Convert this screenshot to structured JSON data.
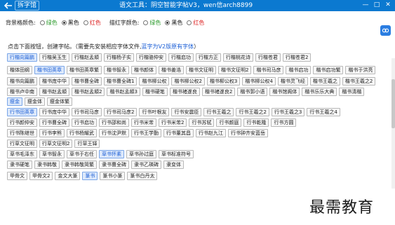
{
  "window": {
    "back_label": "拆字馆",
    "title": "语文工具：阴空智能字帖V3，wen信arch8899",
    "buttons": [
      "—",
      "□",
      "✕"
    ]
  },
  "settings": {
    "bg_label": "背景格颜色:",
    "bg_options": [
      "绿色",
      "黑色",
      "红色"
    ],
    "bg_selected": 1,
    "trace_label": "描红字颜色:",
    "trace_options": [
      "绿色",
      "黑色",
      "红色"
    ],
    "trace_selected": 1
  },
  "hint": {
    "prefix": "点击下面按钮，创建字帖。（需要先安装相应字体文件,",
    "blue": "蓝字为V2版原有字体",
    "suffix": "）"
  },
  "font_rows": [
    [
      {
        "label": "行楷向篇鹏",
        "blue": true,
        "selected": true
      },
      {
        "label": "行楷吴玉生"
      },
      {
        "label": "行楷赵孟頫"
      },
      {
        "label": "行楷杨子实"
      },
      {
        "label": "行楷骆仲安"
      },
      {
        "label": "行楷启功"
      },
      {
        "label": "行楷方正"
      },
      {
        "label": "行楷桃花诗"
      },
      {
        "label": "行楷苍君"
      },
      {
        "label": "行楷苍君2"
      }
    ],
    [
      {
        "label": "楷体田纲"
      },
      {
        "label": "楷书田英章",
        "blue": true,
        "selected": true
      },
      {
        "label": "楷书田英章繁"
      },
      {
        "label": "楷书智永"
      },
      {
        "label": "楷书颜体"
      },
      {
        "label": "楷书姜浩"
      },
      {
        "label": "楷书文征明"
      },
      {
        "label": "楷书文征明2"
      },
      {
        "label": "楷书司马彦"
      },
      {
        "label": "楷书启功"
      },
      {
        "label": "楷书启功繁"
      },
      {
        "label": "楷书于洪亮"
      }
    ],
    [
      {
        "label": "楷书向篇鹏"
      },
      {
        "label": "楷书庞中华"
      },
      {
        "label": "楷书曹全碑"
      },
      {
        "label": "楷书曹全碑1"
      },
      {
        "label": "楷书柳公权"
      },
      {
        "label": "楷书柳公权2"
      },
      {
        "label": "楷书柳公权3"
      },
      {
        "label": "楷书柳公权4"
      },
      {
        "label": "楷书灵飞经"
      },
      {
        "label": "楷书王羲之"
      },
      {
        "label": "楷书王羲之2"
      }
    ],
    [
      {
        "label": "楷书卢中南"
      },
      {
        "label": "楷书赵孟頫"
      },
      {
        "label": "楷书赵孟頫2"
      },
      {
        "label": "楷书赵孟頫3"
      },
      {
        "label": "楷书硬笔"
      },
      {
        "label": "楷书褚遂良"
      },
      {
        "label": "楷书褚遂良2"
      },
      {
        "label": "楷书郭小语"
      },
      {
        "label": "楷书馆阁体"
      },
      {
        "label": "楷书乐乐大典"
      },
      {
        "label": "楷书清楷"
      }
    ],
    [
      {
        "label": "瘦金",
        "blue": true,
        "selected": true
      },
      {
        "label": "瘦金体"
      },
      {
        "label": "瘦金体繁"
      }
    ],
    [
      {
        "label": "行书田英章",
        "blue": true,
        "selected": true
      },
      {
        "label": "行书庞中华"
      },
      {
        "label": "行书司马彦"
      },
      {
        "label": "行书司马彦2"
      },
      {
        "label": "行书叶根友"
      },
      {
        "label": "行书安震臣"
      },
      {
        "label": "行书王羲之"
      },
      {
        "label": "行书王羲之2"
      },
      {
        "label": "行书王羲之3"
      },
      {
        "label": "行书王羲之4"
      }
    ],
    [
      {
        "label": "行书颜仲安"
      },
      {
        "label": "行书曹全碑"
      },
      {
        "label": "行书启功"
      },
      {
        "label": "行书邵和尚"
      },
      {
        "label": "行书米芾"
      },
      {
        "label": "行书米芾2"
      },
      {
        "label": "行书苏轼"
      },
      {
        "label": "行书颜庭"
      },
      {
        "label": "行书乾隆"
      },
      {
        "label": "行书方圆"
      }
    ],
    [
      {
        "label": "行书陈继世"
      },
      {
        "label": "行书李熊"
      },
      {
        "label": "行书杨耀武"
      },
      {
        "label": "行书沈尹默"
      },
      {
        "label": "行书王学勤"
      },
      {
        "label": "行书董其昌"
      },
      {
        "label": "行书赵九江"
      },
      {
        "label": "行书钟齐安蓝岳"
      }
    ],
    [
      {
        "label": "行草文征明"
      },
      {
        "label": "行草文征明2"
      },
      {
        "label": "行草王铎"
      }
    ],
    [
      {
        "label": "草书毛泽东"
      },
      {
        "label": "草书智永"
      },
      {
        "label": "草书于右任"
      },
      {
        "label": "草书怀素",
        "blue": true,
        "selected": true
      },
      {
        "label": "草书孙过庭"
      },
      {
        "label": "草书标准符号"
      }
    ],
    [
      {
        "label": "隶书硬笔"
      },
      {
        "label": "隶书韩敬"
      },
      {
        "label": "隶书韩敬简繁"
      },
      {
        "label": "隶书曹全碑"
      },
      {
        "label": "隶书乙瑛碑"
      },
      {
        "label": "隶变体"
      }
    ],
    [
      {
        "label": "甲骨文"
      },
      {
        "label": "甲骨文2"
      },
      {
        "label": "金文大篆"
      },
      {
        "label": "篆书",
        "blue": true,
        "selected": true
      },
      {
        "label": "篆书小篆"
      },
      {
        "label": "篆书白丹太"
      }
    ]
  ],
  "watermark": "最需教育"
}
